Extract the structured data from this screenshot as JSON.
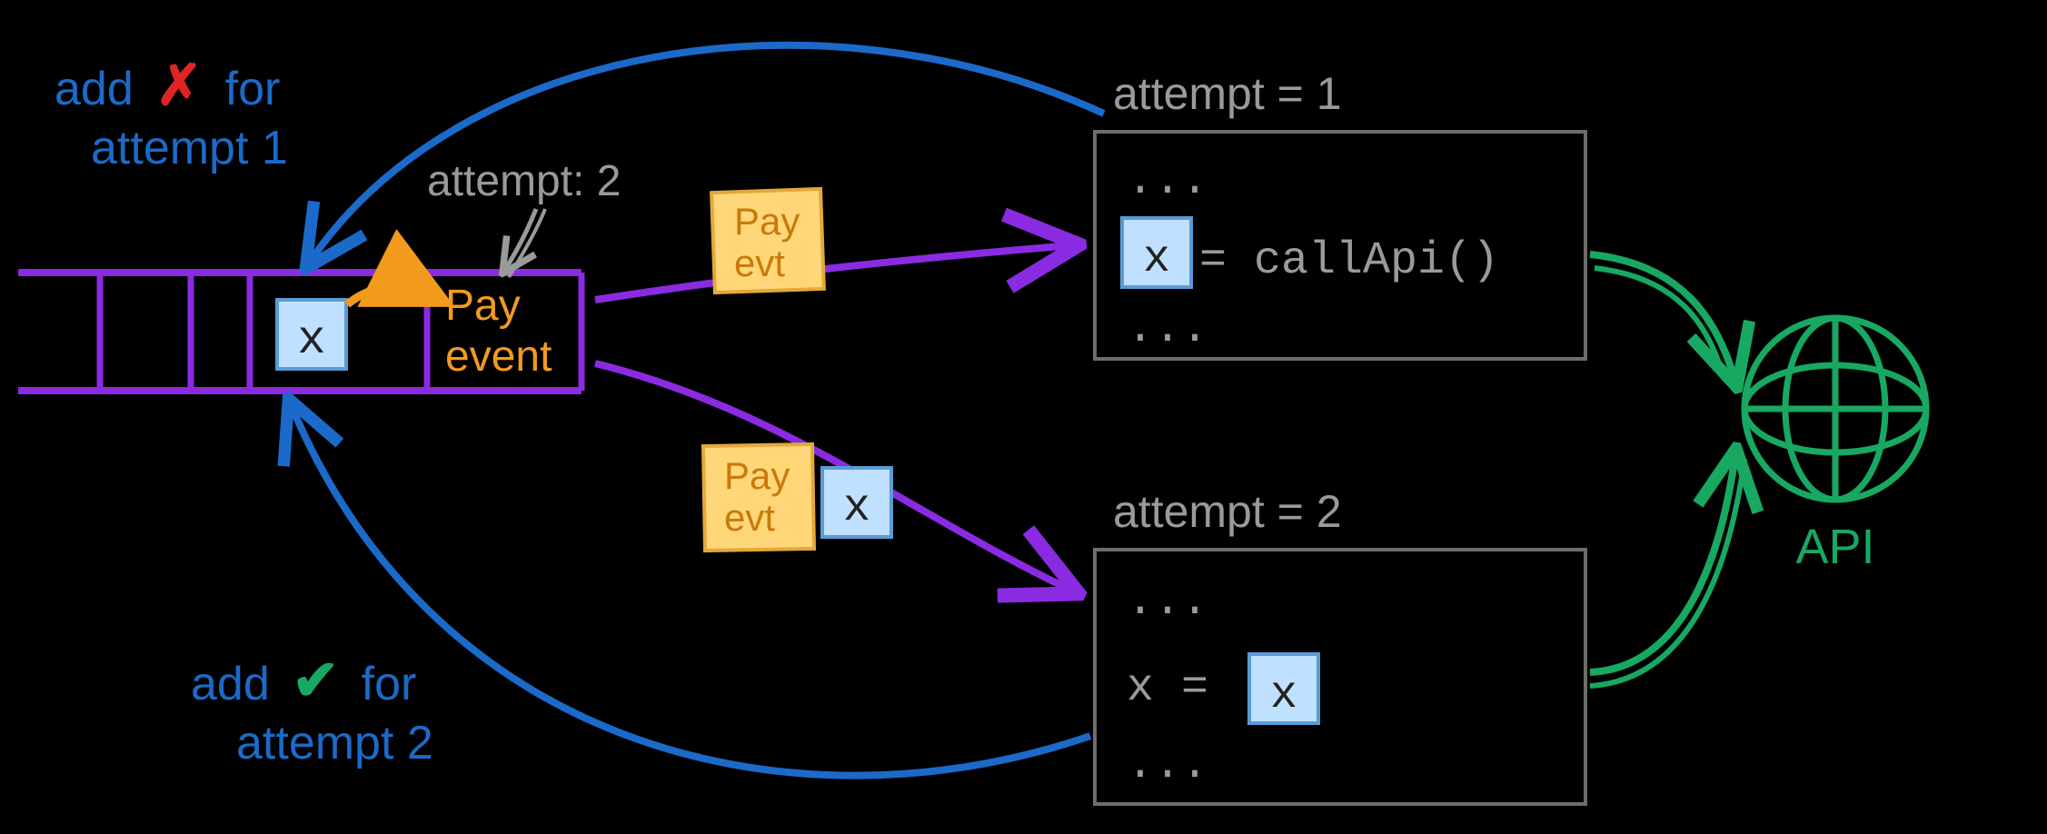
{
  "annotations": {
    "add_fail": {
      "prefix": "add",
      "mark": "✗",
      "suffix": "for",
      "line2": "attempt 1"
    },
    "add_ok": {
      "prefix": "add",
      "mark": "✔",
      "suffix": "for",
      "line2": "attempt 2"
    }
  },
  "queue": {
    "attempt_label": "attempt: 2",
    "result_token": "x",
    "event_label_line1": "Pay",
    "event_label_line2": "event"
  },
  "sticky1": {
    "line1": "Pay",
    "line2": "evt"
  },
  "sticky2": {
    "line1": "Pay",
    "line2": "evt",
    "token": "x"
  },
  "attempt1": {
    "label": "attempt = 1",
    "code_line1": "...",
    "code_var": "x",
    "code_rest": " = callApi()",
    "code_line3": "..."
  },
  "attempt2": {
    "label": "attempt = 2",
    "code_line1": "...",
    "code_prefix": "x = ",
    "code_token": "x",
    "code_line3": "..."
  },
  "api": {
    "label": "API"
  },
  "colors": {
    "blue": "#1b6ac9",
    "red": "#e02424",
    "green": "#18a862",
    "purple": "#8a2be2",
    "purple_dark": "#7a1fd0",
    "orange": "#f29b1d",
    "sticky_fill": "#ffd779",
    "sticky_stroke": "#e3a93a",
    "token_fill": "#bfe0ff",
    "token_stroke": "#5a9bd5",
    "grey": "#9a9a9a",
    "box_stroke": "#6d6d6d"
  }
}
